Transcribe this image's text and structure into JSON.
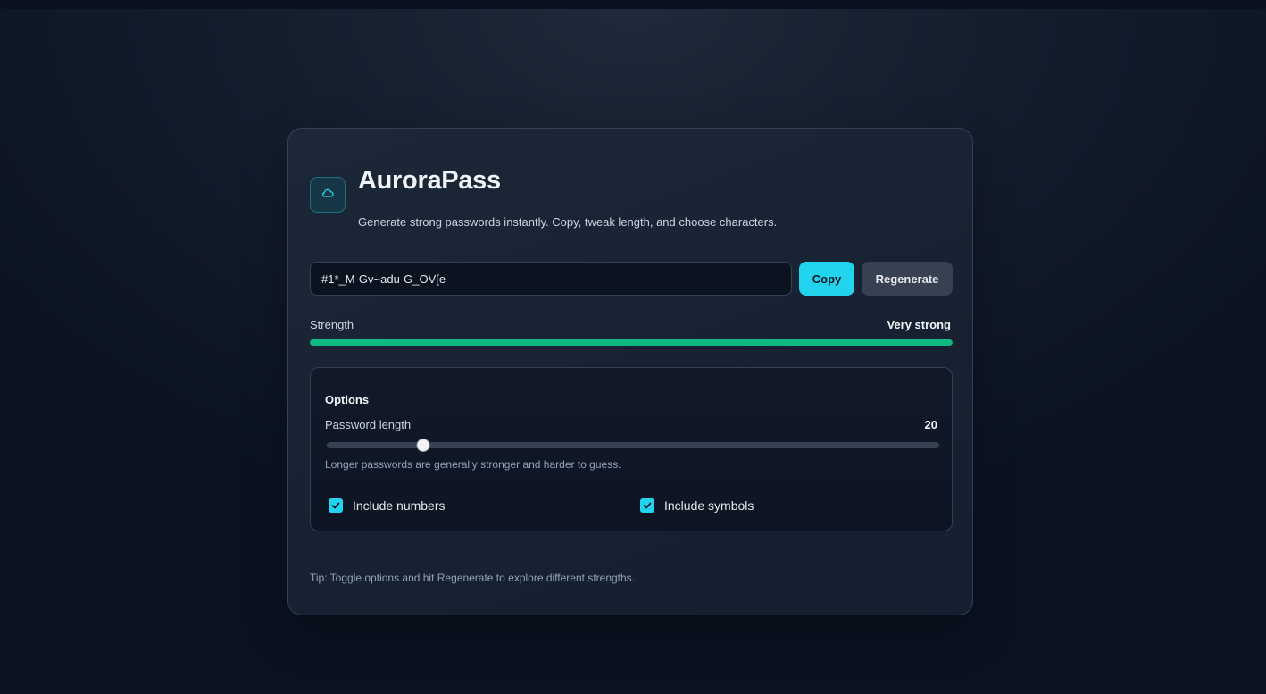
{
  "app": {
    "title": "AuroraPass",
    "subtitle": "Generate strong passwords instantly. Copy, tweak length, and choose characters.",
    "logo_icon": "cloud-icon"
  },
  "password": {
    "value": "#1*_M-Gv~adu-G_OV[e"
  },
  "actions": {
    "copy_label": "Copy",
    "regenerate_label": "Regenerate"
  },
  "strength": {
    "label": "Strength",
    "value_label": "Very strong",
    "level": 1.0,
    "color": "#10b981"
  },
  "options": {
    "title": "Options",
    "length_label": "Password length",
    "length_value": "20",
    "slider_position": 0.158,
    "hint": "Longer passwords are generally stronger and harder to guess.",
    "include_numbers": {
      "label": "Include numbers",
      "checked": true
    },
    "include_symbols": {
      "label": "Include symbols",
      "checked": true
    }
  },
  "tip": "Tip: Toggle options and hit Regenerate to explore different strengths.",
  "colors": {
    "accent": "#22d3ee",
    "strength_bar": "#10b981"
  }
}
